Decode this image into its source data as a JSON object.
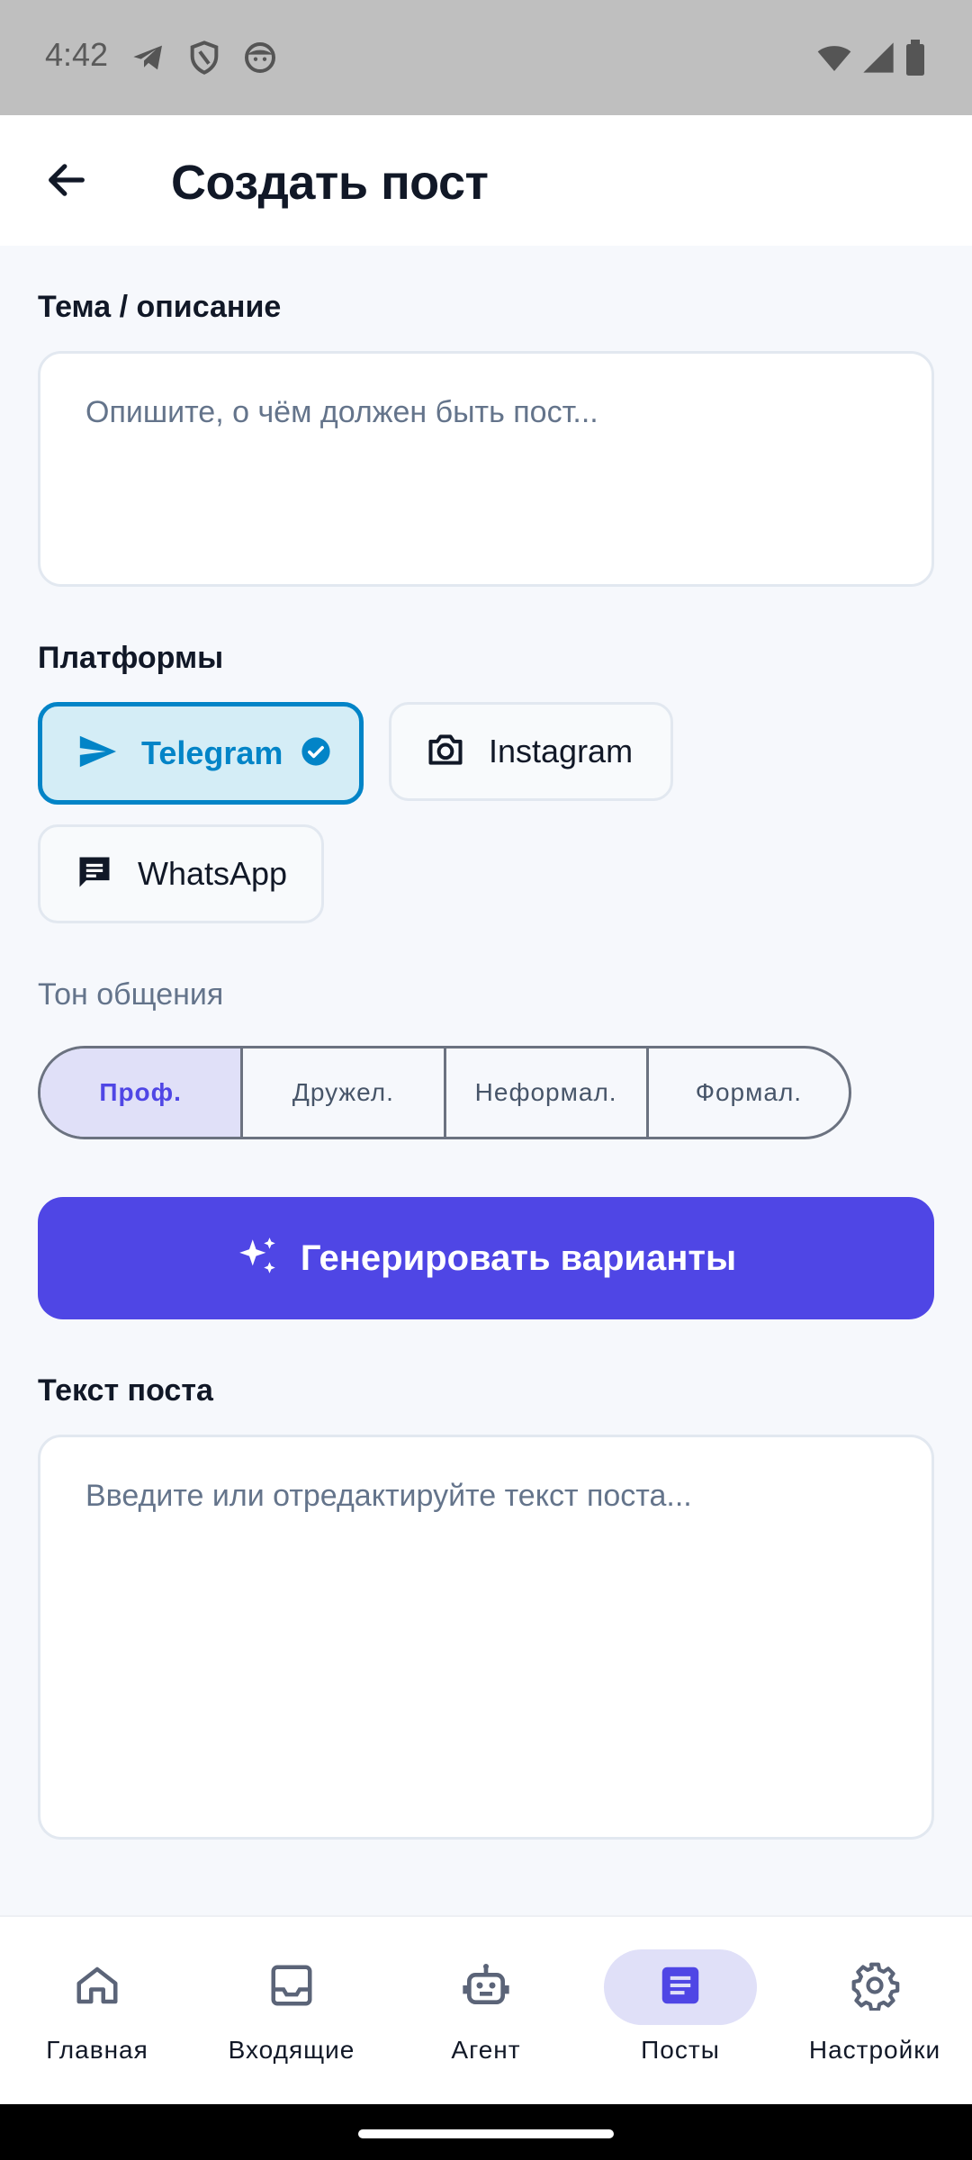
{
  "status_bar": {
    "time": "4:42",
    "left_icons": [
      "telegram-icon",
      "shield-icon",
      "face-icon"
    ],
    "right_icons": [
      "wifi-icon",
      "signal-icon",
      "battery-icon"
    ]
  },
  "header": {
    "back_icon": "arrow-left-icon",
    "title": "Создать пост"
  },
  "topic": {
    "label": "Тема / описание",
    "placeholder": "Опишите, о чём должен быть пост..."
  },
  "platforms": {
    "label": "Платформы",
    "items": [
      {
        "label": "Telegram",
        "icon": "send-icon",
        "selected": true
      },
      {
        "label": "Instagram",
        "icon": "camera-icon",
        "selected": false
      },
      {
        "label": "WhatsApp",
        "icon": "chat-icon",
        "selected": false
      }
    ]
  },
  "tone": {
    "label": "Тон общения",
    "options": [
      {
        "label": "Проф.",
        "active": true
      },
      {
        "label": "Дружел.",
        "active": false
      },
      {
        "label": "Неформал.",
        "active": false
      },
      {
        "label": "Формал.",
        "active": false
      }
    ]
  },
  "generate_button": {
    "label": "Генерировать варианты",
    "icon": "sparkles-icon"
  },
  "post_text": {
    "label": "Текст поста",
    "placeholder": "Введите или отредактируйте текст поста..."
  },
  "bottom_nav": {
    "items": [
      {
        "label": "Главная",
        "icon": "home-icon",
        "active": false
      },
      {
        "label": "Входящие",
        "icon": "inbox-icon",
        "active": false
      },
      {
        "label": "Агент",
        "icon": "robot-icon",
        "active": false
      },
      {
        "label": "Посты",
        "icon": "article-icon",
        "active": true
      },
      {
        "label": "Настройки",
        "icon": "gear-icon",
        "active": false
      }
    ]
  },
  "colors": {
    "accent": "#4f46e5",
    "telegram_selected": "#0284c7",
    "selected_chip_bg": "#d4edf6"
  }
}
